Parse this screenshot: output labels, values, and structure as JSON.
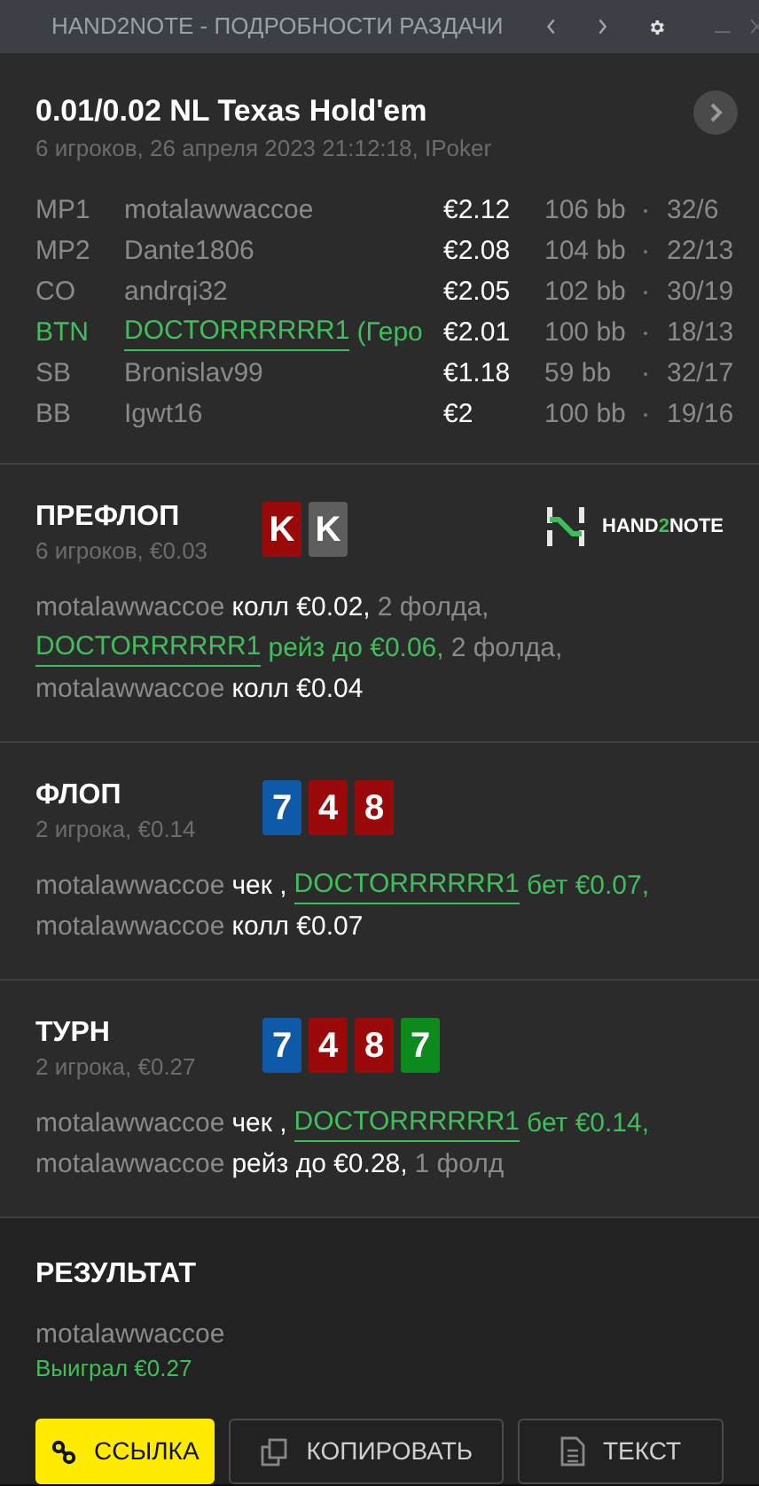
{
  "window": {
    "title": "HAND2NOTE - ПОДРОБНОСТИ РАЗДАЧИ"
  },
  "header": {
    "title": "0.01/0.02 NL Texas Hold'em",
    "subtitle": "6 игроков, 26 апреля 2023 21:12:18, IPoker"
  },
  "players": [
    {
      "position": "MP1",
      "name": "motalawwaccoe",
      "hero": false,
      "stack": "€2.12",
      "bb": "106 bb",
      "stats": "32/6"
    },
    {
      "position": "MP2",
      "name": "Dante1806",
      "hero": false,
      "stack": "€2.08",
      "bb": "104 bb",
      "stats": "22/13"
    },
    {
      "position": "CO",
      "name": "andrqi32",
      "hero": false,
      "stack": "€2.05",
      "bb": "102 bb",
      "stats": "30/19"
    },
    {
      "position": "BTN",
      "name": "DOCTORRRRRR1",
      "suffix": "(Геро",
      "hero": true,
      "stack": "€2.01",
      "bb": "100 bb",
      "stats": "18/13"
    },
    {
      "position": "SB",
      "name": "Bronislav99",
      "hero": false,
      "stack": "€1.18",
      "bb": "59 bb",
      "stats": "32/17"
    },
    {
      "position": "BB",
      "name": "Igwt16",
      "hero": false,
      "stack": "€2",
      "bb": "100 bb",
      "stats": "19/16"
    }
  ],
  "streets": [
    {
      "name": "ПРЕФЛОП",
      "subtitle": "6 игроков, €0.03",
      "logo": [
        "HAND",
        "2",
        "NOTE"
      ],
      "cards": [
        {
          "rank": "K",
          "color": "#9b0a0a"
        },
        {
          "rank": "K",
          "color": "#5e5e5e"
        }
      ],
      "lines": [
        [
          {
            "kind": "player",
            "text": "motalawwaccoe"
          },
          {
            "kind": "action",
            "text": "колл €0.02,"
          },
          {
            "kind": "plain",
            "text": "2 фолда,"
          }
        ],
        [
          {
            "kind": "hero",
            "text": "DOCTORRRRRR1"
          },
          {
            "kind": "hero_action",
            "text": "рейз до €0.06,"
          },
          {
            "kind": "plain",
            "text": "2 фолда,"
          }
        ],
        [
          {
            "kind": "player",
            "text": "motalawwaccoe"
          },
          {
            "kind": "action",
            "text": "колл €0.04"
          }
        ]
      ]
    },
    {
      "name": "ФЛОП",
      "subtitle": "2 игрока, €0.14",
      "cards": [
        {
          "rank": "7",
          "color": "#0f5aa8"
        },
        {
          "rank": "4",
          "color": "#9b0a0a"
        },
        {
          "rank": "8",
          "color": "#9b0a0a"
        }
      ],
      "lines": [
        [
          {
            "kind": "player",
            "text": "motalawwaccoe"
          },
          {
            "kind": "action",
            "text": "чек ,"
          },
          {
            "kind": "hero",
            "text": "DOCTORRRRRR1"
          },
          {
            "kind": "hero_action",
            "text": "бет €0.07,"
          }
        ],
        [
          {
            "kind": "player",
            "text": "motalawwaccoe"
          },
          {
            "kind": "action",
            "text": "колл €0.07"
          }
        ]
      ]
    },
    {
      "name": "ТУРН",
      "subtitle": "2 игрока, €0.27",
      "cards": [
        {
          "rank": "7",
          "color": "#0f5aa8"
        },
        {
          "rank": "4",
          "color": "#9b0a0a"
        },
        {
          "rank": "8",
          "color": "#9b0a0a"
        },
        {
          "rank": "7",
          "color": "#0c8a1c"
        }
      ],
      "lines": [
        [
          {
            "kind": "player",
            "text": "motalawwaccoe"
          },
          {
            "kind": "action",
            "text": "чек ,"
          },
          {
            "kind": "hero",
            "text": "DOCTORRRRRR1"
          },
          {
            "kind": "hero_action",
            "text": "бет €0.14,"
          }
        ],
        [
          {
            "kind": "player",
            "text": "motalawwaccoe"
          },
          {
            "kind": "action",
            "text": "рейз до €0.28,"
          },
          {
            "kind": "plain",
            "text": "1 фолд"
          }
        ]
      ]
    }
  ],
  "result": {
    "title": "РЕЗУЛЬТАТ",
    "winner": "motalawwaccoe",
    "won": "Выиграл €0.27"
  },
  "buttons": [
    {
      "kind": "link",
      "label": "ССЫЛКА",
      "primary": true
    },
    {
      "kind": "copy",
      "label": "КОПИРОВАТЬ",
      "primary": false
    },
    {
      "kind": "text",
      "label": "ТЕКСТ",
      "primary": false
    }
  ]
}
